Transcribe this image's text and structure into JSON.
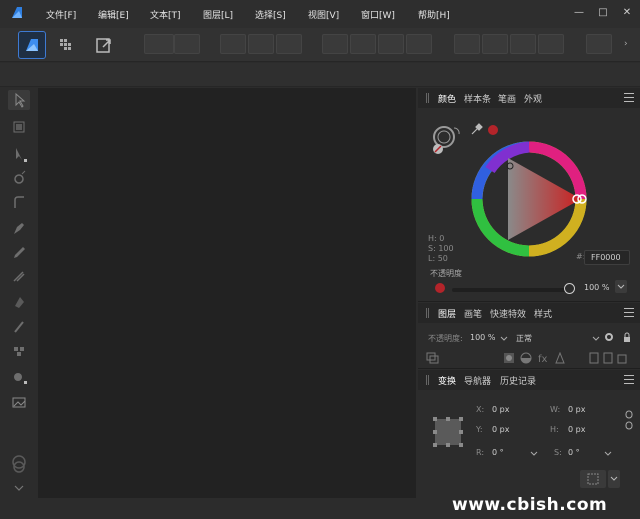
{
  "menu": {
    "items": [
      "文件[F]",
      "编辑[E]",
      "文本[T]",
      "图层[L]",
      "选择[S]",
      "视图[V]",
      "窗口[W]",
      "帮助[H]"
    ]
  },
  "window_controls": {
    "minimize": "—",
    "maximize": "□",
    "close": "✕"
  },
  "color_panel": {
    "tabs": [
      "颜色",
      "样本条",
      "笔画",
      "外观"
    ],
    "hsl": {
      "h": "H: 0",
      "s": "S: 100",
      "l": "L: 50"
    },
    "hex_prefix": "#:",
    "hex_value": "FF0000",
    "opacity_label": "不透明度",
    "opacity_value": "100 %",
    "accent": "#b3242a"
  },
  "layers_panel": {
    "tabs": [
      "图层",
      "画笔",
      "快速特效",
      "样式"
    ],
    "opacity_label": "不透明度:",
    "opacity_value": "100 %",
    "blend_mode": "正常"
  },
  "transform_panel": {
    "tabs": [
      "变换",
      "导航器",
      "历史记录"
    ],
    "x": {
      "label": "X:",
      "value": "0 px"
    },
    "w": {
      "label": "W:",
      "value": "0 px"
    },
    "y": {
      "label": "Y:",
      "value": "0 px"
    },
    "h": {
      "label": "H:",
      "value": "0 px"
    },
    "r": {
      "label": "R:",
      "value": "0 °"
    },
    "s": {
      "label": "S:",
      "value": "0 °"
    }
  },
  "watermark": "www.cbish.com"
}
